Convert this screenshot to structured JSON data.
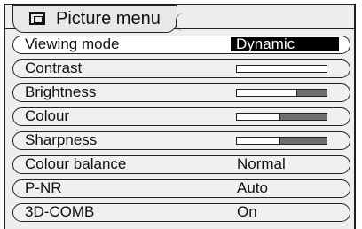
{
  "menu": {
    "title": "Picture menu",
    "title_icon": "picture-screen-icon",
    "colors": {
      "selected_value_background": "#000000",
      "selected_value_text": "#ffffff",
      "bar_remainder": "#6f6f6f"
    },
    "rows": [
      {
        "label": "Viewing mode",
        "type": "value",
        "value": "Dynamic",
        "selected": true
      },
      {
        "label": "Contrast",
        "type": "bar",
        "level": 1.0
      },
      {
        "label": "Brightness",
        "type": "bar",
        "level": 0.67
      },
      {
        "label": "Colour",
        "type": "bar",
        "level": 0.49
      },
      {
        "label": "Sharpness",
        "type": "bar",
        "level": 0.49
      },
      {
        "label": "Colour balance",
        "type": "value",
        "value": "Normal"
      },
      {
        "label": "P-NR",
        "type": "value",
        "value": "Auto"
      },
      {
        "label": "3D-COMB",
        "type": "value",
        "value": "On"
      }
    ]
  }
}
